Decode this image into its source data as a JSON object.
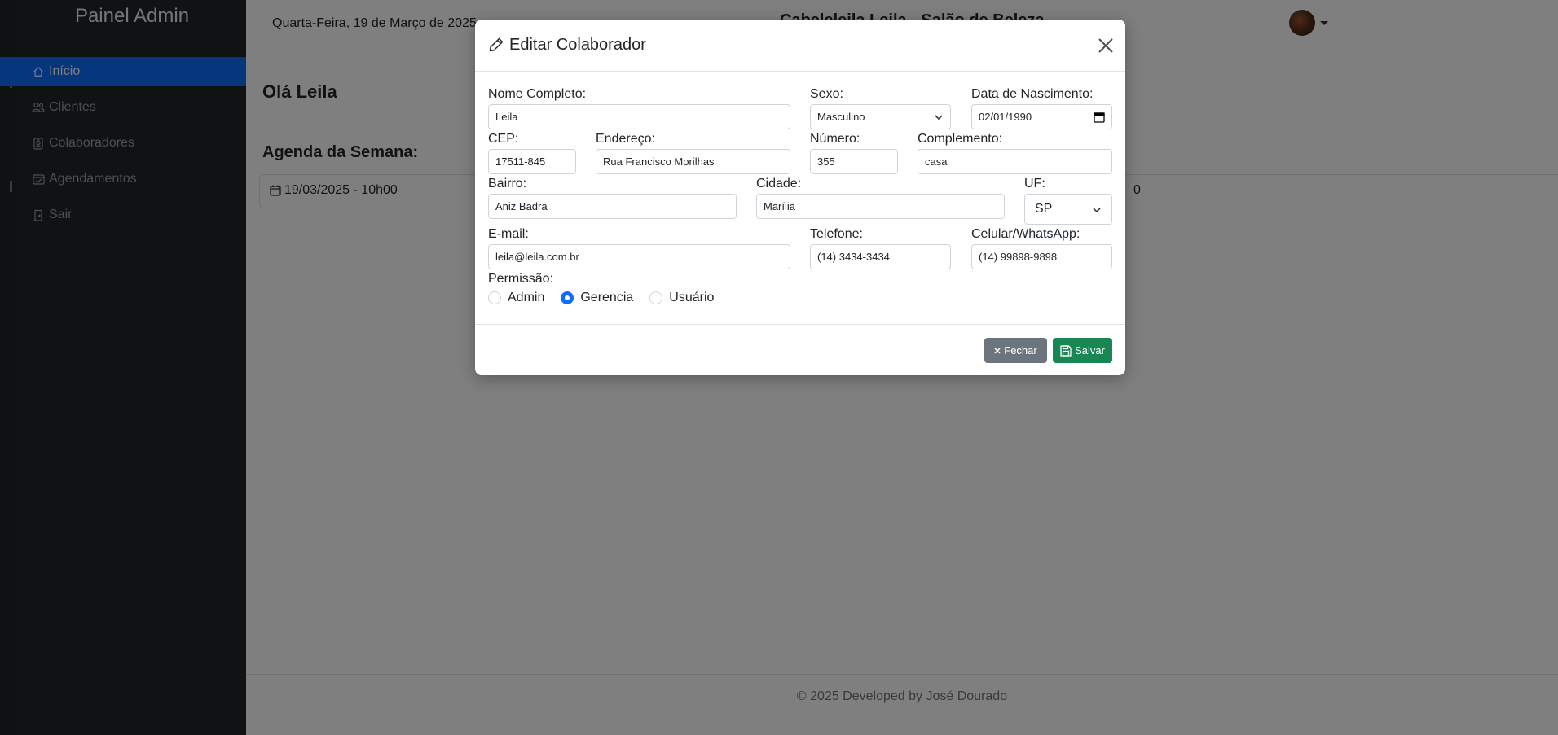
{
  "sidebar": {
    "brand": "Painel Admin",
    "items": [
      {
        "label": "Início",
        "icon": "house-icon",
        "active": true
      },
      {
        "label": "Clientes",
        "icon": "people-icon"
      },
      {
        "label": "Colaboradores",
        "icon": "badge-icon"
      },
      {
        "label": "Agendamentos",
        "icon": "calendar-check-icon"
      },
      {
        "label": "Sair",
        "icon": "door-exit-icon"
      }
    ]
  },
  "topbar": {
    "date": "Quarta-Feira, 19 de Março de 2025",
    "site_title": "Cabeleleila Leila - Salão de Beleza"
  },
  "main": {
    "greeting": "Olá Leila",
    "week_title": "Agenda da Semana:",
    "agenda_item": "19/03/2025 - 10h00",
    "agenda_right": "0"
  },
  "footer": {
    "text": "© 2025 Developed by José Dourado"
  },
  "modal": {
    "title": "Editar Colaborador",
    "fields": {
      "nome": {
        "label": "Nome Completo:",
        "value": "Leila"
      },
      "sexo": {
        "label": "Sexo:",
        "value": "Masculino"
      },
      "nascimento": {
        "label": "Data de Nascimento:",
        "value": "02/01/1990"
      },
      "cep": {
        "label": "CEP:",
        "value": "17511-845"
      },
      "endereco": {
        "label": "Endereço:",
        "value": "Rua Francisco Morilhas"
      },
      "numero": {
        "label": "Número:",
        "value": "355"
      },
      "complemento": {
        "label": "Complemento:",
        "value": "casa"
      },
      "bairro": {
        "label": "Bairro:",
        "value": "Aniz Badra"
      },
      "cidade": {
        "label": "Cidade:",
        "value": "Marília"
      },
      "uf": {
        "label": "UF:",
        "value": "SP"
      },
      "email": {
        "label": "E-mail:",
        "value": "leila@leila.com.br"
      },
      "telefone": {
        "label": "Telefone:",
        "value": "(14) 3434-3434"
      },
      "celular": {
        "label": "Celular/WhatsApp:",
        "value": "(14) 99898-9898"
      }
    },
    "permissao": {
      "label": "Permissão:",
      "options": [
        "Admin",
        "Gerencia",
        "Usuário"
      ],
      "selected": "Gerencia"
    },
    "buttons": {
      "close": "Fechar",
      "save": "Salvar"
    }
  },
  "colors": {
    "primary": "#0d6efd",
    "success": "#198754",
    "secondary": "#6c757d",
    "sidebar_bg": "#212529"
  }
}
